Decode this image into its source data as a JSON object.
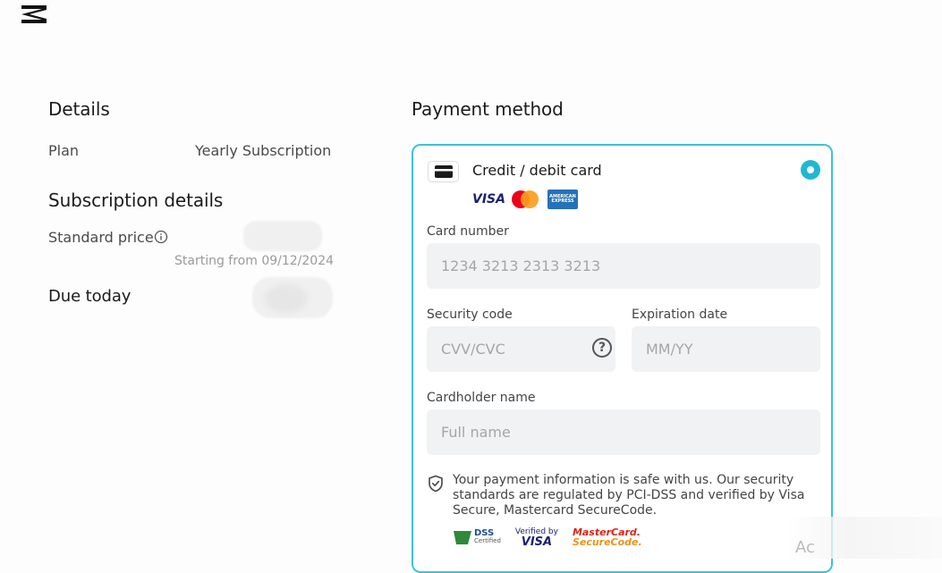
{
  "details": {
    "title": "Details",
    "plan_label": "Plan",
    "plan_value": "Yearly Subscription"
  },
  "subscription": {
    "title": "Subscription details",
    "standard_price_label": "Standard price",
    "starting_from": "Starting from 09/12/2024",
    "due_today_label": "Due today"
  },
  "payment": {
    "title": "Payment method",
    "method_title": "Credit / debit card",
    "brands": {
      "visa": "VISA",
      "amex": "AMERICAN EXPRESS"
    },
    "card_number_label": "Card number",
    "card_number_placeholder": "1234 3213 2313 3213",
    "security_code_label": "Security code",
    "security_code_placeholder": "CVV/CVC",
    "help_glyph": "?",
    "expiration_label": "Expiration date",
    "expiration_placeholder": "MM/YY",
    "cardholder_label": "Cardholder name",
    "cardholder_placeholder": "Full name",
    "safety_text": "Your payment information is safe with us. Our security standards are regulated by PCI-DSS and verified by Visa Secure, Mastercard SecureCode.",
    "certs": {
      "pci": "DSS",
      "pci_sub": "Certified",
      "verified_by": "Verified by",
      "verified_visa": "VISA",
      "mastercard": "MasterCard.",
      "securecode": "SecureCode."
    }
  },
  "watermark": "Ac",
  "colors": {
    "accent": "#1fb8d2",
    "border": "#3cc4d6"
  }
}
